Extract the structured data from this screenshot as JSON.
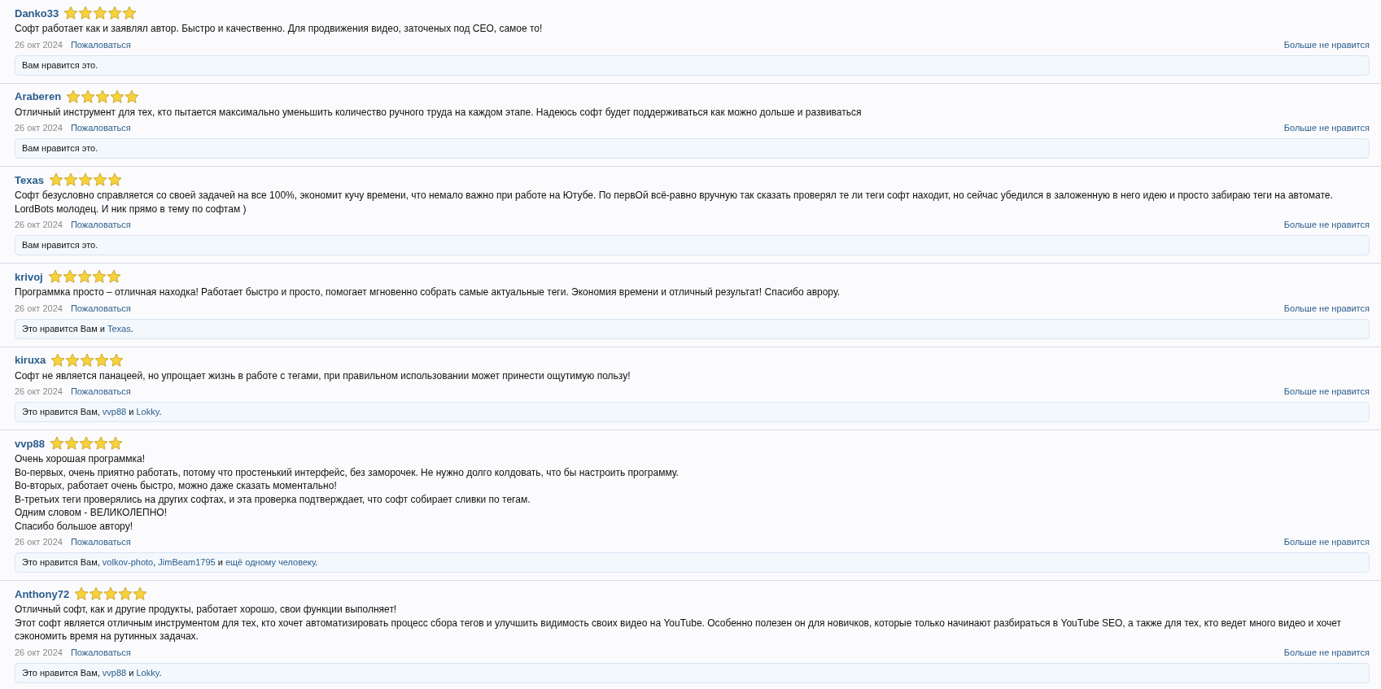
{
  "reviews": [
    {
      "author": "Danko33",
      "stars": 5,
      "body": [
        "Софт работает как и заявлял автор. Быстро и качественно. Для продвижения видео, заточеных под СЕО, самое то!"
      ],
      "date": "26 окт 2024",
      "report": "Пожаловаться",
      "unlike": "Больше не нравится",
      "likes": [
        {
          "kind": "text",
          "text": "Вам нравится это."
        }
      ]
    },
    {
      "author": "Araberen",
      "stars": 5,
      "body": [
        "Отличный инструмент для тех, кто пытается максимально уменьшить количество ручного труда на каждом этапе. Надеюсь софт будет поддерживаться как можно дольше и развиваться"
      ],
      "date": "26 окт 2024",
      "report": "Пожаловаться",
      "unlike": "Больше не нравится",
      "likes": [
        {
          "kind": "text",
          "text": "Вам нравится это."
        }
      ]
    },
    {
      "author": "Texas",
      "stars": 5,
      "body": [
        "Софт безусловно справляется со своей задачей на все 100%, экономит кучу времени, что немало важно при работе на Ютубе. По первОй всё-равно вручную так сказать проверял те ли теги софт находит, но сейчас убедился в заложенную в него идею и просто забираю теги на автомате. LordBots молодец. И ник прямо в тему по софтам )"
      ],
      "date": "26 окт 2024",
      "report": "Пожаловаться",
      "unlike": "Больше не нравится",
      "likes": [
        {
          "kind": "text",
          "text": "Вам нравится это."
        }
      ]
    },
    {
      "author": "krivoj",
      "stars": 5,
      "body": [
        "Программка просто – отличная находка! Работает быстро и просто, помогает мгновенно собрать самые актуальные теги. Экономия времени и отличный результат! Спасибо аврору."
      ],
      "date": "26 окт 2024",
      "report": "Пожаловаться",
      "unlike": "Больше не нравится",
      "likes": [
        {
          "kind": "text",
          "text": "Это нравится Вам и "
        },
        {
          "kind": "link",
          "text": "Texas"
        },
        {
          "kind": "text",
          "text": "."
        }
      ]
    },
    {
      "author": "kiruxa",
      "stars": 5,
      "body": [
        "Софт не является панацеей, но упрощает жизнь в работе с тегами, при правильном использовании может принести ощутимую пользу!"
      ],
      "date": "26 окт 2024",
      "report": "Пожаловаться",
      "unlike": "Больше не нравится",
      "likes": [
        {
          "kind": "text",
          "text": "Это нравится Вам, "
        },
        {
          "kind": "link",
          "text": "vvp88"
        },
        {
          "kind": "text",
          "text": " и "
        },
        {
          "kind": "link",
          "text": "Lokky"
        },
        {
          "kind": "text",
          "text": "."
        }
      ]
    },
    {
      "author": "vvp88",
      "stars": 5,
      "body": [
        "Очень хорошая программка!",
        "Во-первых, очень приятно работать, потому что простенький интерфейс, без заморочек. Не нужно долго колдовать, что бы настроить программу.",
        "Во-вторых, работает очень быстро, можно даже сказать моментально!",
        "В-третьих теги проверялись на других софтах, и эта проверка подтверждает, что софт собирает сливки по тегам.",
        "Одним словом - ВЕЛИКОЛЕПНО!",
        "Спасибо большое автору!"
      ],
      "date": "26 окт 2024",
      "report": "Пожаловаться",
      "unlike": "Больше не нравится",
      "likes": [
        {
          "kind": "text",
          "text": "Это нравится Вам, "
        },
        {
          "kind": "link",
          "text": "volkov-photo"
        },
        {
          "kind": "text",
          "text": ", "
        },
        {
          "kind": "link",
          "text": "JimBeam1795"
        },
        {
          "kind": "text",
          "text": " и "
        },
        {
          "kind": "link",
          "text": "ещё одному человеку"
        },
        {
          "kind": "text",
          "text": "."
        }
      ]
    },
    {
      "author": "Anthony72",
      "stars": 5,
      "body": [
        "Отличный софт, как и другие продукты, работает хорошо, свои функции выполняет!",
        "Этот софт является отличным инструментом для тех, кто хочет автоматизировать процесс сбора тегов и улучшить видимость своих видео на YouTube. Особенно полезен он для новичков, которые только начинают разбираться в YouTube SEO, а также для тех, кто ведет много видео и хочет сэкономить время на рутинных задачах."
      ],
      "date": "26 окт 2024",
      "report": "Пожаловаться",
      "unlike": "Больше не нравится",
      "likes": [
        {
          "kind": "text",
          "text": "Это нравится Вам, "
        },
        {
          "kind": "link",
          "text": "vvp88"
        },
        {
          "kind": "text",
          "text": " и "
        },
        {
          "kind": "link",
          "text": "Lokky"
        },
        {
          "kind": "text",
          "text": "."
        }
      ]
    }
  ]
}
